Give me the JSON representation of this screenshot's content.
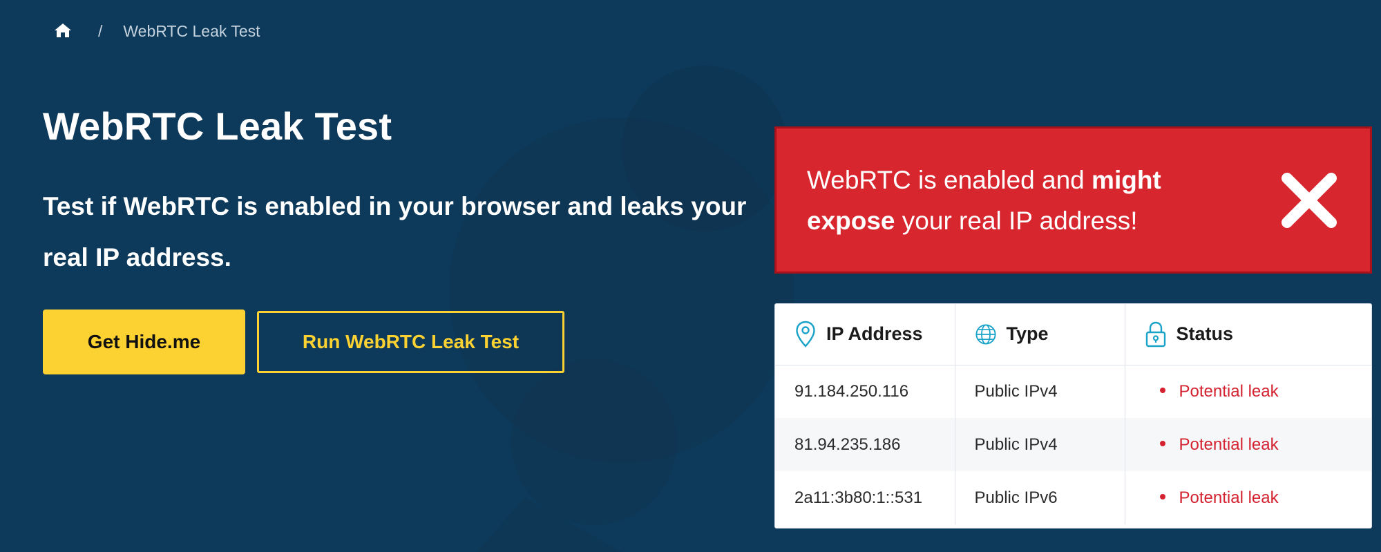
{
  "breadcrumb": {
    "home_icon": "home-icon",
    "separator": "/",
    "current": "WebRTC Leak Test"
  },
  "hero": {
    "title": "WebRTC Leak Test",
    "subtitle": "Test if WebRTC is enabled in your browser and leaks your real IP address."
  },
  "buttons": {
    "primary_label": "Get Hide.me",
    "secondary_label": "Run WebRTC Leak Test"
  },
  "alert": {
    "text_before": "WebRTC is enabled and ",
    "text_bold": "might expose",
    "text_after": " your real IP address!",
    "icon": "close-x-icon",
    "color": "#d8262f"
  },
  "table": {
    "columns": [
      {
        "label": "IP Address",
        "icon": "location-pin-icon"
      },
      {
        "label": "Type",
        "icon": "globe-icon"
      },
      {
        "label": "Status",
        "icon": "lock-icon"
      }
    ],
    "rows": [
      {
        "ip": "91.184.250.116",
        "type": "Public IPv4",
        "status": "Potential leak"
      },
      {
        "ip": "81.94.235.186",
        "type": "Public IPv4",
        "status": "Potential leak"
      },
      {
        "ip": "2a11:3b80:1::531",
        "type": "Public IPv6",
        "status": "Potential leak"
      }
    ]
  },
  "colors": {
    "background": "#0d3a5a",
    "accent": "#fcd232",
    "danger": "#d8262f",
    "icon_teal": "#1aa3c8"
  }
}
